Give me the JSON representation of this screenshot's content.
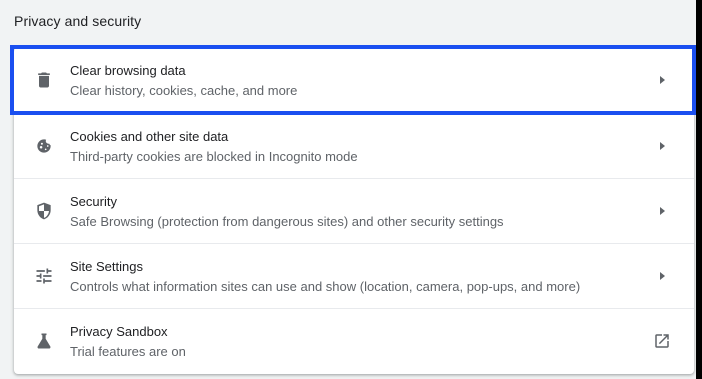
{
  "section": {
    "title": "Privacy and security"
  },
  "rows": [
    {
      "icon": "trash-icon",
      "title": "Clear browsing data",
      "subtitle": "Clear history, cookies, cache, and more",
      "end_icon": "arrow-right-icon"
    },
    {
      "icon": "cookie-icon",
      "title": "Cookies and other site data",
      "subtitle": "Third-party cookies are blocked in Incognito mode",
      "end_icon": "arrow-right-icon"
    },
    {
      "icon": "shield-icon",
      "title": "Security",
      "subtitle": "Safe Browsing (protection from dangerous sites) and other security settings",
      "end_icon": "arrow-right-icon"
    },
    {
      "icon": "tune-icon",
      "title": "Site Settings",
      "subtitle": "Controls what information sites can use and show (location, camera, pop-ups, and more)",
      "end_icon": "arrow-right-icon"
    },
    {
      "icon": "flask-icon",
      "title": "Privacy Sandbox",
      "subtitle": "Trial features are on",
      "end_icon": "open-in-new-icon"
    }
  ],
  "colors": {
    "highlight": "#1a4ff0",
    "background": "#f1f3f4",
    "text": "#202124",
    "secondary_text": "#5f6368"
  }
}
